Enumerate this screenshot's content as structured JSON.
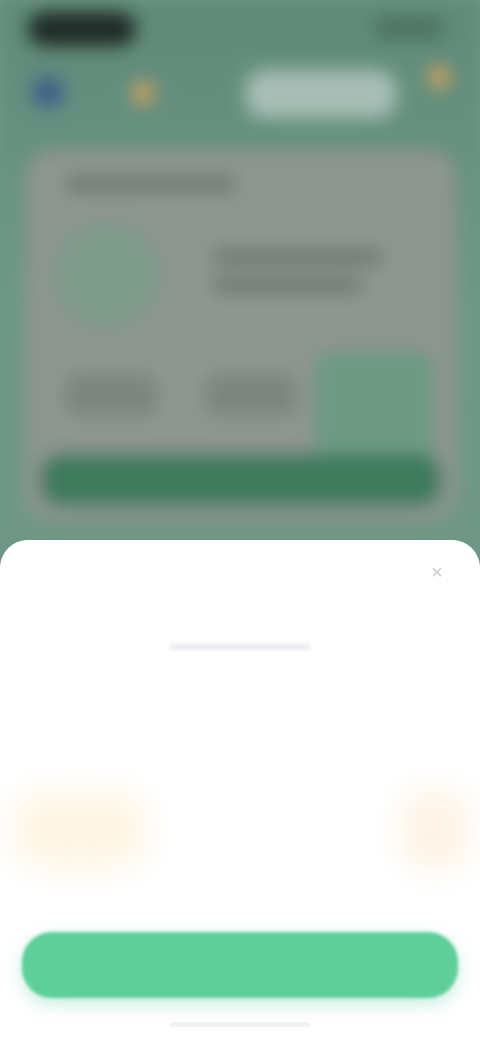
{
  "sheet": {
    "close_symbol": "×",
    "title": "",
    "features": [
      {
        "label": "",
        "value": "",
        "sub": ""
      },
      {
        "label": "",
        "value": "",
        "sub": ""
      },
      {
        "label": "",
        "value": "",
        "sub": ""
      }
    ],
    "cta_label": ""
  },
  "colors": {
    "accent": "#5ecf9a",
    "title": "#3f4d84",
    "background_app": "#6d9786",
    "sheet": "#ffffff"
  },
  "icons": {
    "close": "close-icon",
    "header_left": "app-icon",
    "header_badges": [
      "coin-icon",
      "coin-icon"
    ]
  }
}
